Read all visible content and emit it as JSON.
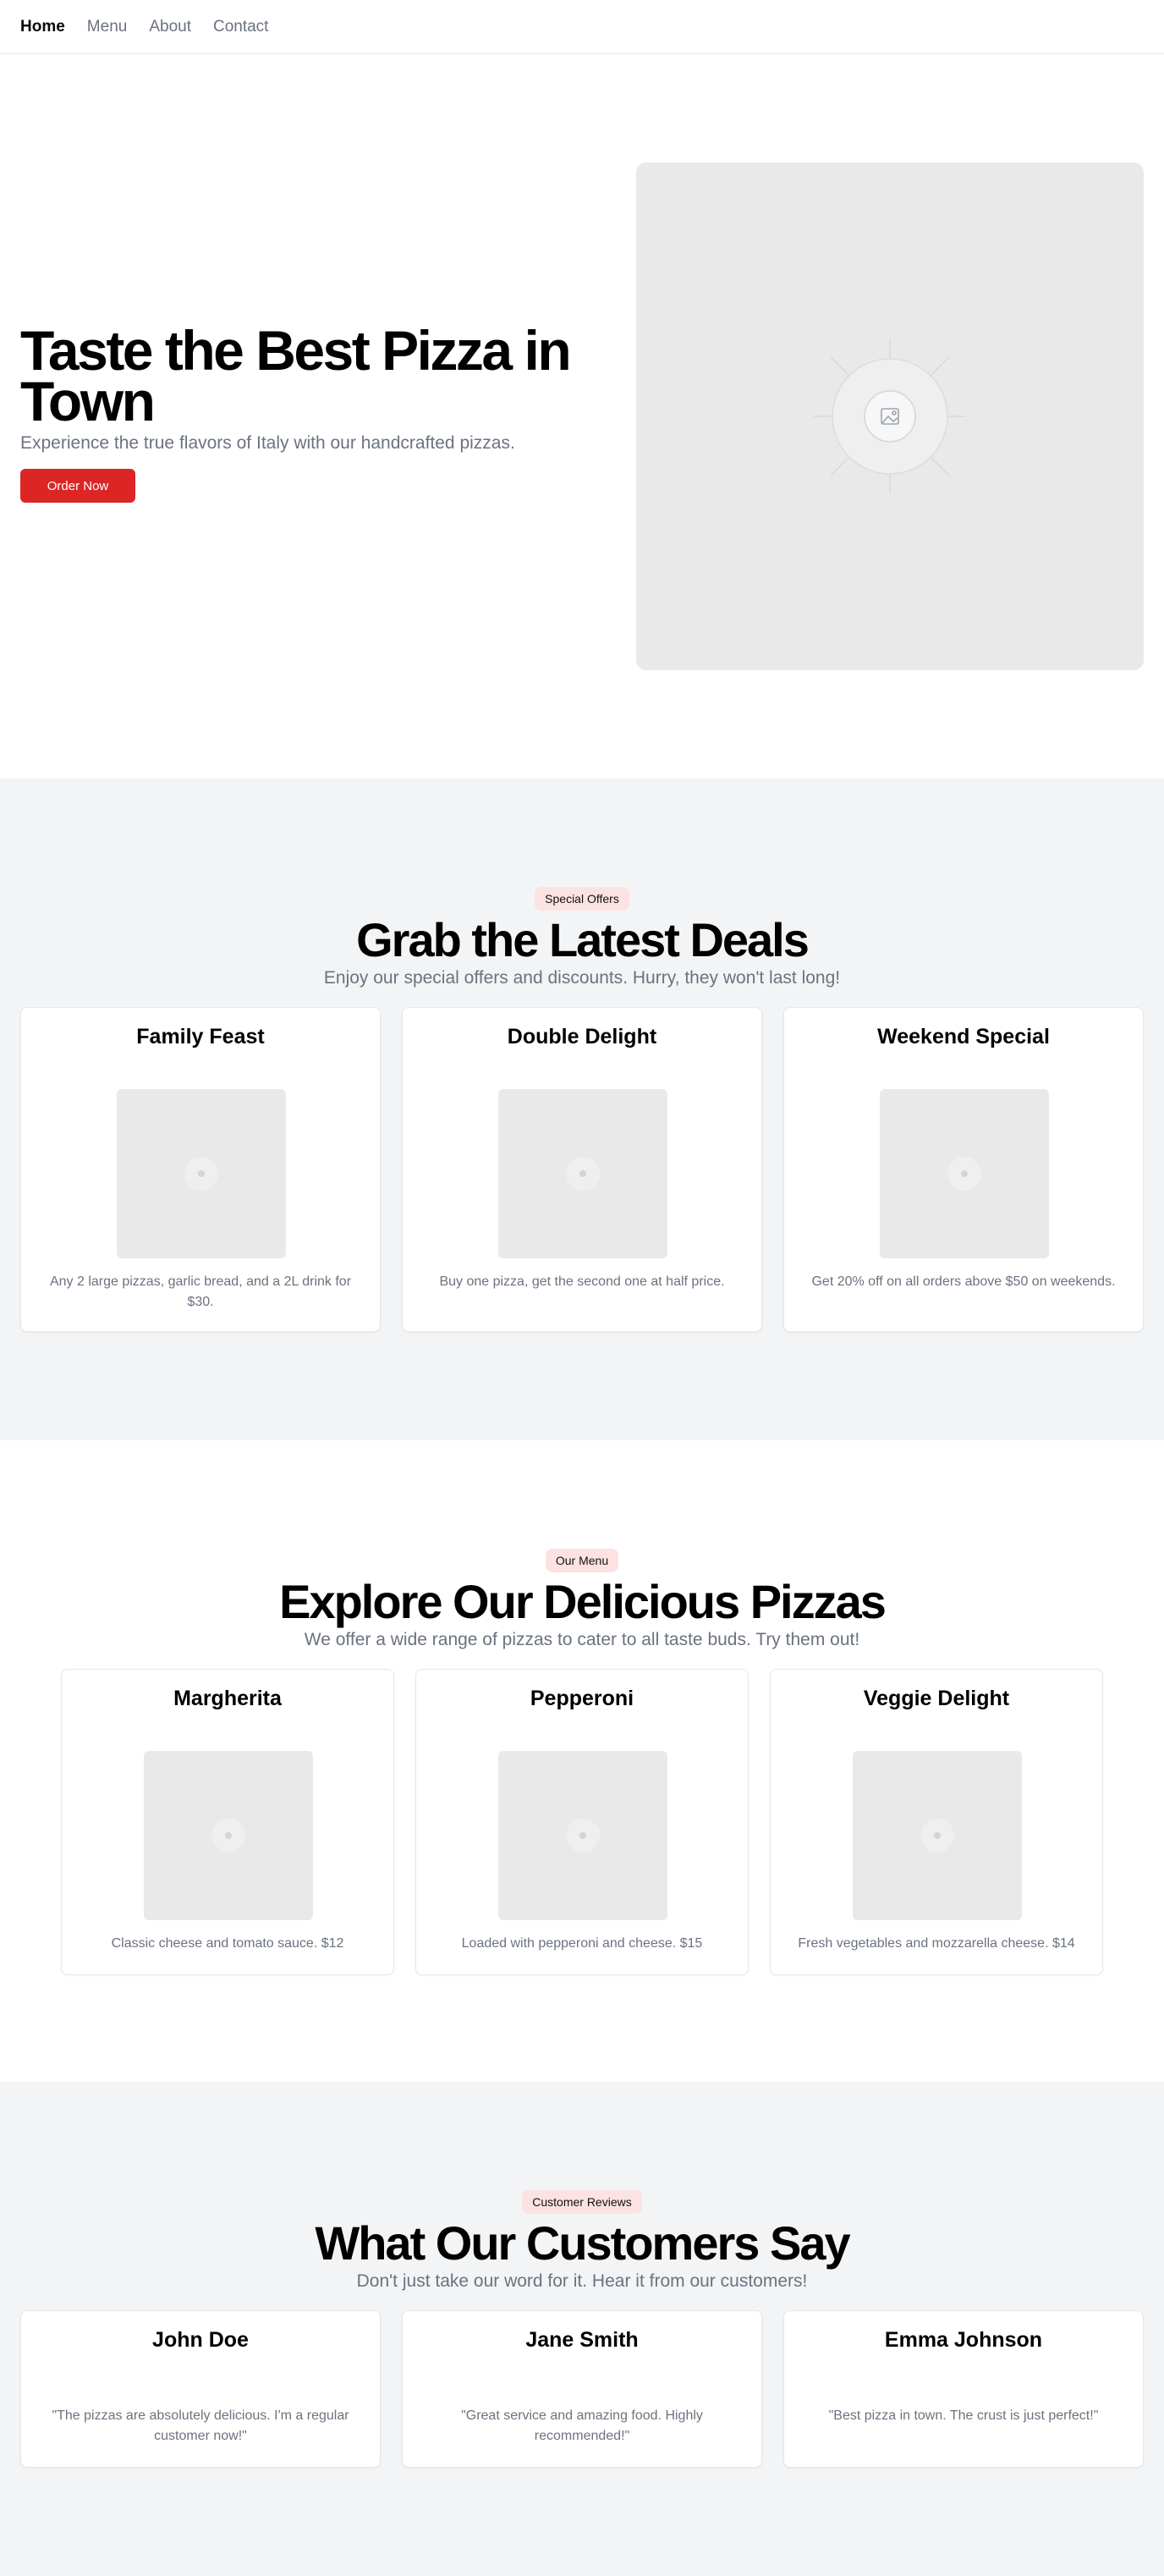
{
  "nav": {
    "items": [
      {
        "label": "Home",
        "active": true
      },
      {
        "label": "Menu"
      },
      {
        "label": "About"
      },
      {
        "label": "Contact"
      }
    ]
  },
  "hero": {
    "title": "Taste the Best Pizza in Town",
    "subtitle": "Experience the true flavors of Italy with our handcrafted pizzas.",
    "cta_label": "Order Now",
    "image_icon": "image-placeholder-icon"
  },
  "deals": {
    "badge": "Special Offers",
    "title": "Grab the Latest Deals",
    "subtitle": "Enjoy our special offers and discounts. Hurry, they won't last long!",
    "cards": [
      {
        "title": "Family Feast",
        "description": "Any 2 large pizzas, garlic bread, and a 2L drink for $30."
      },
      {
        "title": "Double Delight",
        "description": "Buy one pizza, get the second one at half price."
      },
      {
        "title": "Weekend Special",
        "description": "Get 20% off on all orders above $50 on weekends."
      }
    ]
  },
  "menu": {
    "badge": "Our Menu",
    "title": "Explore Our Delicious Pizzas",
    "subtitle": "We offer a wide range of pizzas to cater to all taste buds. Try them out!",
    "cards": [
      {
        "title": "Margherita",
        "description": "Classic cheese and tomato sauce. $12"
      },
      {
        "title": "Pepperoni",
        "description": "Loaded with pepperoni and cheese. $15"
      },
      {
        "title": "Veggie Delight",
        "description": "Fresh vegetables and mozzarella cheese. $14"
      }
    ]
  },
  "reviews": {
    "badge": "Customer Reviews",
    "title": "What Our Customers Say",
    "subtitle": "Don't just take our word for it. Hear it from our customers!",
    "cards": [
      {
        "name": "John Doe",
        "quote": "\"The pizzas are absolutely delicious. I'm a regular customer now!\""
      },
      {
        "name": "Jane Smith",
        "quote": "\"Great service and amazing food. Highly recommended!\""
      },
      {
        "name": "Emma Johnson",
        "quote": "\"Best pizza in town. The crust is just perfect!\""
      }
    ]
  },
  "colors": {
    "accent": "#dc2626",
    "badge_bg": "#fde2e2",
    "muted_text": "#6b7280",
    "section_bg": "#f3f4f6",
    "placeholder": "#e9e9e9"
  }
}
